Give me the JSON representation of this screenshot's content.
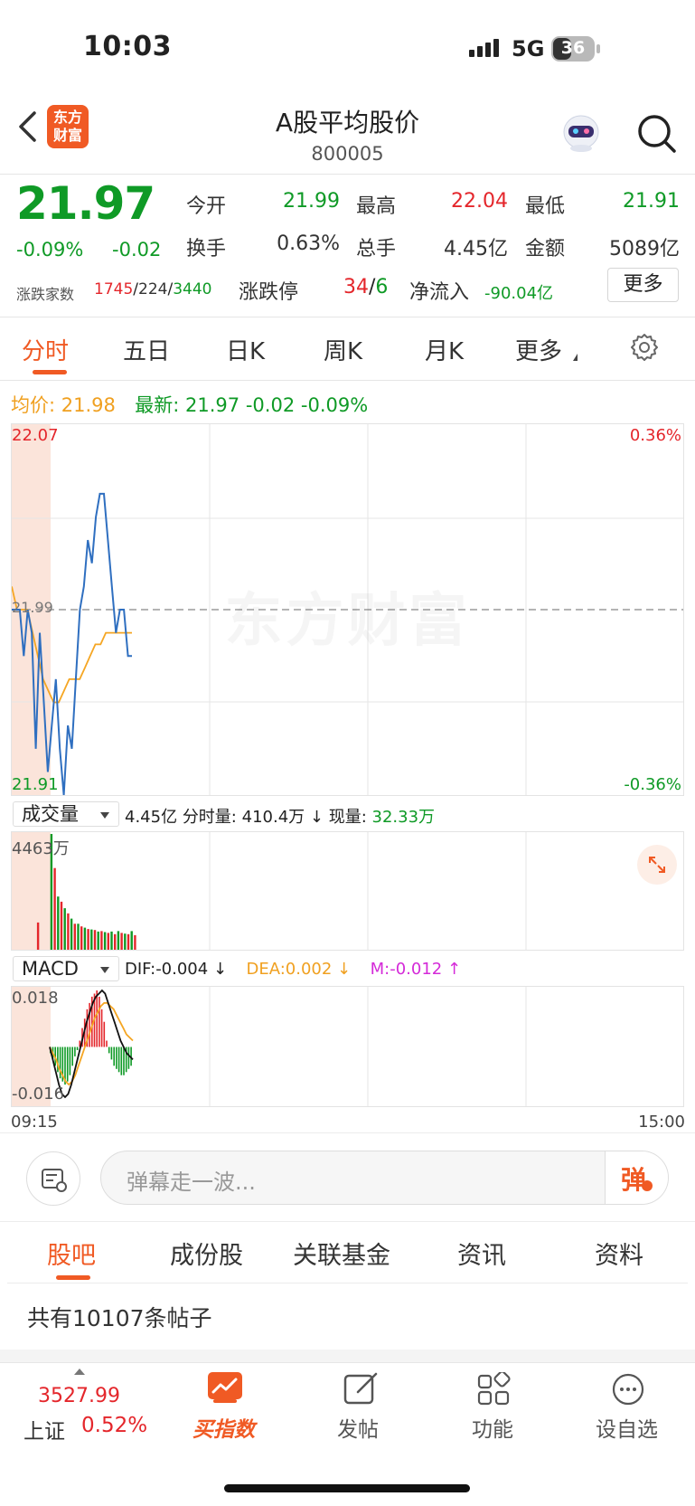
{
  "status_bar": {
    "time": "10:03",
    "network": "5G",
    "battery": "36"
  },
  "header": {
    "title": "A股平均股价",
    "code": "800005",
    "logo_line1": "东方",
    "logo_line2": "财富"
  },
  "quote": {
    "price": "21.97",
    "change_pct": "-0.09%",
    "change": "-0.02",
    "open_label": "今开",
    "open": "21.99",
    "high_label": "最高",
    "high": "22.04",
    "low_label": "最低",
    "low": "21.91",
    "turnover_label": "换手",
    "turnover": "0.63%",
    "volume_label": "总手",
    "volume": "4.45亿",
    "amount_label": "金额",
    "amount": "5089亿",
    "breadth_label": "涨跌家数",
    "breadth_up": "1745",
    "breadth_flat": "224",
    "breadth_down": "3440",
    "limit_label": "涨跌停",
    "limit_up": "34",
    "limit_down": "6",
    "netflow_label": "净流入",
    "netflow": "-90.04亿",
    "more_button": "更多"
  },
  "period_tabs": {
    "items": [
      "分时",
      "五日",
      "日K",
      "周K",
      "月K",
      "更多"
    ],
    "active": "分时"
  },
  "legend": {
    "avg_label": "均价:",
    "avg": "21.98",
    "latest_label": "最新:",
    "latest": "21.97",
    "latest_change": "-0.02",
    "latest_pct": "-0.09%"
  },
  "chart_labels": {
    "price_top": "22.07",
    "price_mid": "21.99",
    "price_bottom": "21.91",
    "pct_top": "0.36%",
    "pct_bottom": "-0.36%",
    "watermark": "东方财富"
  },
  "volume_bar": {
    "selector": "成交量",
    "total": "4.45亿",
    "minute_label": "分时量:",
    "minute": "410.4万",
    "current_label": "现量:",
    "current": "32.33万",
    "max": "4463万"
  },
  "macd_bar": {
    "selector": "MACD",
    "dif": "DIF:-0.004",
    "dea": "DEA:0.002",
    "m": "M:-0.012",
    "top": "0.018",
    "bottom": "-0.016"
  },
  "time_axis": {
    "start": "09:15",
    "end": "15:00"
  },
  "danmu": {
    "placeholder": "弹幕走一波...",
    "send_label": "弹"
  },
  "section_tabs": {
    "items": [
      "股吧",
      "成份股",
      "关联基金",
      "资讯",
      "资料"
    ],
    "active": "股吧"
  },
  "posts": {
    "count_text": "共有10107条帖子"
  },
  "bottom_nav": {
    "index_value": "3527.99",
    "index_name": "上证",
    "index_pct": "0.52%",
    "items": [
      "买指数",
      "发帖",
      "功能",
      "设自选"
    ]
  },
  "colors": {
    "up": "#e4262b",
    "down": "#0f9a26",
    "price_line": "#2f6fc0",
    "avg_line": "#f5a623",
    "accent": "#f05a24"
  },
  "chart_data": [
    {
      "type": "line",
      "title": "",
      "x_start": "09:15",
      "x_end": "15:00",
      "ylim": [
        21.91,
        22.07
      ],
      "series": [
        {
          "name": "最新",
          "values": [
            21.99,
            21.99,
            21.99,
            21.97,
            21.99,
            21.98,
            21.93,
            21.98,
            21.95,
            21.92,
            21.94,
            21.96,
            21.93,
            21.91,
            21.94,
            21.93,
            21.96,
            21.99,
            22.0,
            22.02,
            22.01,
            22.03,
            22.04,
            22.04,
            22.02,
            22.0,
            21.98,
            21.99,
            21.99,
            21.97,
            21.97
          ]
        },
        {
          "name": "均价",
          "values": [
            22.0,
            21.99,
            21.99,
            21.99,
            21.98,
            21.97,
            21.96,
            21.955,
            21.95,
            21.95,
            21.955,
            21.96,
            21.96,
            21.96,
            21.965,
            21.97,
            21.975,
            21.975,
            21.98,
            21.98,
            21.98,
            21.98,
            21.98,
            21.98
          ]
        }
      ]
    },
    {
      "type": "bar",
      "title": "",
      "ylim": [
        0,
        4463
      ],
      "ylabel": "万",
      "series": [
        {
          "name": "成交量",
          "values": [
            0,
            0,
            0,
            0,
            0,
            0,
            0,
            1050,
            0,
            0,
            0,
            4463,
            3150,
            2050,
            1850,
            1600,
            1400,
            1200,
            1000,
            1000,
            900,
            850,
            800,
            780,
            760,
            700,
            720,
            680,
            650,
            700,
            600,
            720,
            650,
            620,
            600,
            720,
            560
          ]
        }
      ],
      "colors": [
        "down",
        "down",
        "down",
        "down",
        "down",
        "down",
        "down",
        "up",
        "down",
        "down",
        "down",
        "down",
        "up",
        "down",
        "up",
        "down",
        "up",
        "down",
        "up",
        "down",
        "up",
        "down",
        "up",
        "down",
        "up",
        "down",
        "up",
        "down",
        "up",
        "down",
        "up",
        "down",
        "up",
        "down",
        "up",
        "down",
        "up"
      ]
    },
    {
      "type": "bar",
      "title": "",
      "ylim": [
        -0.016,
        0.018
      ],
      "series": [
        {
          "name": "M",
          "values": [
            -0.002,
            -0.004,
            -0.006,
            -0.008,
            -0.01,
            -0.011,
            -0.012,
            -0.011,
            -0.009,
            -0.006,
            -0.003,
            -0.001,
            0.002,
            0.006,
            0.009,
            0.012,
            0.014,
            0.016,
            0.017,
            0.018,
            0.016,
            0.012,
            0.008,
            0.002,
            -0.002,
            -0.004,
            -0.006,
            -0.007,
            -0.008,
            -0.009,
            -0.009,
            -0.008,
            -0.007,
            -0.006
          ]
        },
        {
          "name": "DIF",
          "values": [
            0.0,
            -0.004,
            -0.008,
            -0.012,
            -0.015,
            -0.016,
            -0.015,
            -0.012,
            -0.008,
            -0.004,
            0.0,
            0.004,
            0.008,
            0.011,
            0.014,
            0.016,
            0.017,
            0.018,
            0.017,
            0.014,
            0.011,
            0.008,
            0.005,
            0.002,
            0.0,
            -0.002,
            -0.003,
            -0.004
          ]
        },
        {
          "name": "DEA",
          "values": [
            0.0,
            -0.002,
            -0.004,
            -0.007,
            -0.009,
            -0.011,
            -0.012,
            -0.011,
            -0.009,
            -0.006,
            -0.003,
            0.0,
            0.003,
            0.006,
            0.009,
            0.011,
            0.013,
            0.014,
            0.014,
            0.013,
            0.012,
            0.01,
            0.008,
            0.006,
            0.004,
            0.003,
            0.002
          ]
        }
      ]
    }
  ]
}
